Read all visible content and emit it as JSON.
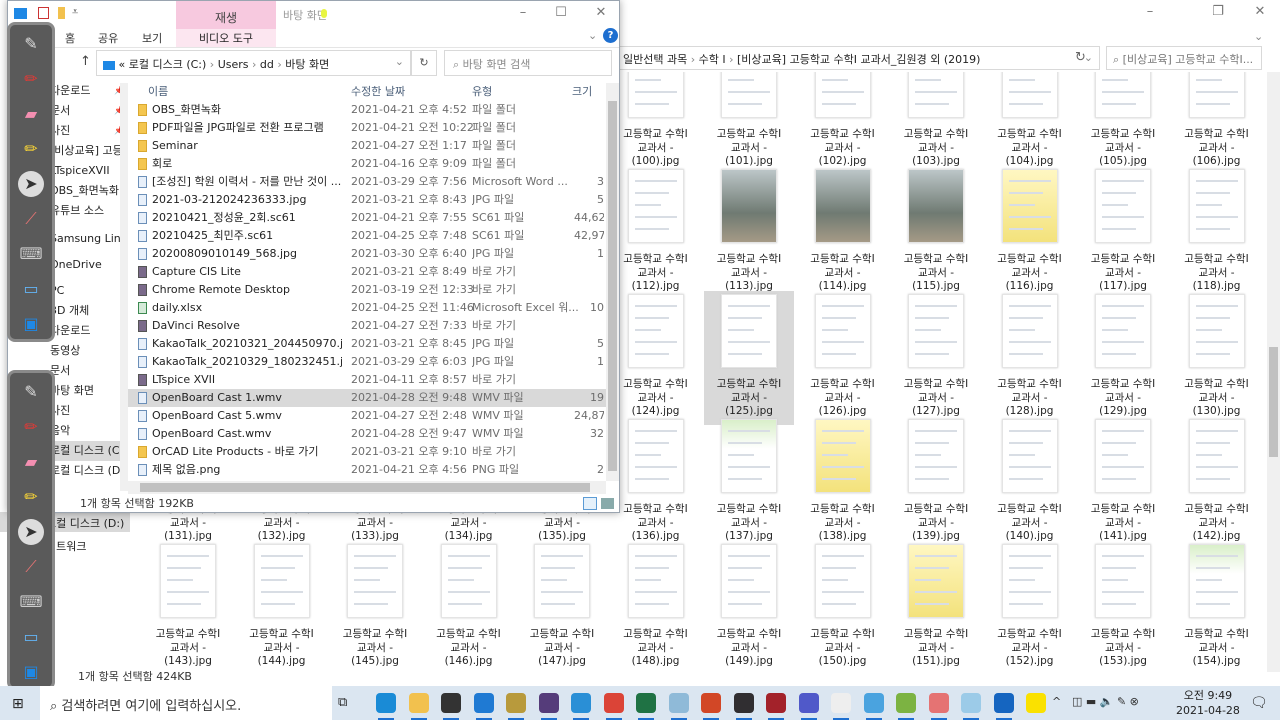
{
  "background_window": {
    "breadcrumb": [
      "일반선택 과목",
      "수학 I",
      "[비상교육] 고등학교 수학I 교과서_김원경 외 (2019)"
    ],
    "search_placeholder": "[비상교육] 고등학교 수학I...",
    "nav": [
      "로컬 디스크 (D:)",
      "네트워크"
    ],
    "status": "1개 항목 선택함 424KB",
    "label_line1": "고등학교 수학I",
    "label_line2": "교과서 -",
    "selected_file": "(125).jpg",
    "thumbnails": [
      {
        "file": "(100).jpg",
        "kind": "doc",
        "col": 5,
        "row": 0
      },
      {
        "file": "(101).jpg",
        "kind": "doc",
        "col": 6,
        "row": 0
      },
      {
        "file": "(102).jpg",
        "kind": "doc",
        "col": 7,
        "row": 0
      },
      {
        "file": "(103).jpg",
        "kind": "doc",
        "col": 8,
        "row": 0
      },
      {
        "file": "(104).jpg",
        "kind": "doc",
        "col": 9,
        "row": 0
      },
      {
        "file": "(105).jpg",
        "kind": "doc",
        "col": 10,
        "row": 0
      },
      {
        "file": "(106).jpg",
        "kind": "doc",
        "col": 11,
        "row": 0
      },
      {
        "file": "(112).jpg",
        "kind": "doc",
        "col": 5,
        "row": 1
      },
      {
        "file": "(113).jpg",
        "kind": "photo",
        "col": 6,
        "row": 1
      },
      {
        "file": "(114).jpg",
        "kind": "photo",
        "col": 7,
        "row": 1
      },
      {
        "file": "(115).jpg",
        "kind": "photo",
        "col": 8,
        "row": 1
      },
      {
        "file": "(116).jpg",
        "kind": "yellow",
        "col": 9,
        "row": 1
      },
      {
        "file": "(117).jpg",
        "kind": "doc",
        "col": 10,
        "row": 1
      },
      {
        "file": "(118).jpg",
        "kind": "doc",
        "col": 11,
        "row": 1
      },
      {
        "file": "(124).jpg",
        "kind": "doc",
        "col": 5,
        "row": 2
      },
      {
        "file": "(125).jpg",
        "kind": "doc",
        "col": 6,
        "row": 2
      },
      {
        "file": "(126).jpg",
        "kind": "doc",
        "col": 7,
        "row": 2
      },
      {
        "file": "(127).jpg",
        "kind": "doc",
        "col": 8,
        "row": 2
      },
      {
        "file": "(128).jpg",
        "kind": "doc",
        "col": 9,
        "row": 2
      },
      {
        "file": "(129).jpg",
        "kind": "doc",
        "col": 10,
        "row": 2
      },
      {
        "file": "(130).jpg",
        "kind": "doc",
        "col": 11,
        "row": 2
      },
      {
        "file": "(131).jpg",
        "kind": "doc",
        "col": 0,
        "row": 3
      },
      {
        "file": "(132).jpg",
        "kind": "doc",
        "col": 1,
        "row": 3
      },
      {
        "file": "(133).jpg",
        "kind": "doc",
        "col": 2,
        "row": 3
      },
      {
        "file": "(134).jpg",
        "kind": "doc",
        "col": 3,
        "row": 3
      },
      {
        "file": "(135).jpg",
        "kind": "doc",
        "col": 4,
        "row": 3
      },
      {
        "file": "(136).jpg",
        "kind": "doc",
        "col": 5,
        "row": 3
      },
      {
        "file": "(137).jpg",
        "kind": "green",
        "col": 6,
        "row": 3
      },
      {
        "file": "(138).jpg",
        "kind": "yellow",
        "col": 7,
        "row": 3
      },
      {
        "file": "(139).jpg",
        "kind": "doc",
        "col": 8,
        "row": 3
      },
      {
        "file": "(140).jpg",
        "kind": "doc",
        "col": 9,
        "row": 3
      },
      {
        "file": "(141).jpg",
        "kind": "doc",
        "col": 10,
        "row": 3
      },
      {
        "file": "(142).jpg",
        "kind": "doc",
        "col": 11,
        "row": 3
      },
      {
        "file": "(143).jpg",
        "kind": "doc",
        "col": 0,
        "row": 4
      },
      {
        "file": "(144).jpg",
        "kind": "doc",
        "col": 1,
        "row": 4
      },
      {
        "file": "(145).jpg",
        "kind": "doc",
        "col": 2,
        "row": 4
      },
      {
        "file": "(146).jpg",
        "kind": "doc",
        "col": 3,
        "row": 4
      },
      {
        "file": "(147).jpg",
        "kind": "doc",
        "col": 4,
        "row": 4
      },
      {
        "file": "(148).jpg",
        "kind": "doc",
        "col": 5,
        "row": 4
      },
      {
        "file": "(149).jpg",
        "kind": "doc",
        "col": 6,
        "row": 4
      },
      {
        "file": "(150).jpg",
        "kind": "doc",
        "col": 7,
        "row": 4
      },
      {
        "file": "(151).jpg",
        "kind": "yellow",
        "col": 8,
        "row": 4
      },
      {
        "file": "(152).jpg",
        "kind": "doc",
        "col": 9,
        "row": 4
      },
      {
        "file": "(153).jpg",
        "kind": "doc",
        "col": 10,
        "row": 4
      },
      {
        "file": "(154).jpg",
        "kind": "green",
        "col": 11,
        "row": 4
      }
    ]
  },
  "front_window": {
    "title": "바탕 화면",
    "context_tab": "재생",
    "ribbon_tabs": [
      "홈",
      "공유",
      "보기",
      "비디오 도구"
    ],
    "address": {
      "prefix": "«",
      "parts": [
        "로컬 디스크 (C:)",
        "Users",
        "dd",
        "바탕 화면"
      ]
    },
    "search_placeholder": "바탕 화면 검색",
    "nav": [
      {
        "label": "다운로드",
        "pinned": true
      },
      {
        "label": "문서",
        "pinned": true
      },
      {
        "label": "사진",
        "pinned": true
      },
      {
        "label": "[비상교육] 고등학"
      },
      {
        "label": "LTspiceXVII"
      },
      {
        "label": "OBS_화면녹화"
      },
      {
        "label": "유튜브 소스"
      },
      {
        "label": "Samsung Link"
      },
      {
        "label": "OneDrive"
      },
      {
        "label": "PC"
      },
      {
        "label": "3D 개체"
      },
      {
        "label": "다운로드"
      },
      {
        "label": "동영상"
      },
      {
        "label": "문서"
      },
      {
        "label": "바탕 화면"
      },
      {
        "label": "사진"
      },
      {
        "label": "음악"
      },
      {
        "label": "로컬 디스크 (C:)",
        "selected": true
      },
      {
        "label": "로컬 디스크 (D:)"
      }
    ],
    "columns": [
      "이름",
      "수정한 날짜",
      "유형",
      "크기"
    ],
    "files": [
      {
        "name": "OBS_화면녹화",
        "date": "2021-04-21 오후 4:52",
        "type": "파일 폴더",
        "size": "",
        "icon": "folder"
      },
      {
        "name": "PDF파일을 JPG파일로 전환 프로그램",
        "date": "2021-04-21 오전 10:22",
        "type": "파일 폴더",
        "size": "",
        "icon": "folder"
      },
      {
        "name": "Seminar",
        "date": "2021-04-27 오전 1:17",
        "type": "파일 폴더",
        "size": "",
        "icon": "folder"
      },
      {
        "name": "회로",
        "date": "2021-04-16 오후 9:09",
        "type": "파일 폴더",
        "size": "",
        "icon": "folder"
      },
      {
        "name": "[조성진] 학원 이력서 - 저를 만난 것이 ...",
        "date": "2021-03-29 오후 7:56",
        "type": "Microsoft Word ...",
        "size": "3",
        "icon": "file"
      },
      {
        "name": "2021-03-212024236333.jpg",
        "date": "2021-03-21 오후 8:43",
        "type": "JPG 파일",
        "size": "5",
        "icon": "file"
      },
      {
        "name": "20210421_정성윤_2회.sc61",
        "date": "2021-04-21 오후 7:55",
        "type": "SC61 파일",
        "size": "44,62",
        "icon": "file"
      },
      {
        "name": "20210425_최민주.sc61",
        "date": "2021-04-25 오후 7:48",
        "type": "SC61 파일",
        "size": "42,97",
        "icon": "file"
      },
      {
        "name": "20200809010149_568.jpg",
        "date": "2021-03-30 오후 6:40",
        "type": "JPG 파일",
        "size": "1",
        "icon": "file"
      },
      {
        "name": "Capture CIS Lite",
        "date": "2021-03-21 오후 8:49",
        "type": "바로 가기",
        "size": "",
        "icon": "short"
      },
      {
        "name": "Chrome Remote Desktop",
        "date": "2021-03-19 오전 12:33",
        "type": "바로 가기",
        "size": "",
        "icon": "short"
      },
      {
        "name": "daily.xlsx",
        "date": "2021-04-25 오전 11:46",
        "type": "Microsoft Excel 워...",
        "size": "10",
        "icon": "xls"
      },
      {
        "name": "DaVinci Resolve",
        "date": "2021-04-27 오전 7:33",
        "type": "바로 가기",
        "size": "",
        "icon": "short"
      },
      {
        "name": "KakaoTalk_20210321_204450970.jpg",
        "date": "2021-03-21 오후 8:45",
        "type": "JPG 파일",
        "size": "5",
        "icon": "file"
      },
      {
        "name": "KakaoTalk_20210329_180232451.jpg",
        "date": "2021-03-29 오후 6:03",
        "type": "JPG 파일",
        "size": "1",
        "icon": "file"
      },
      {
        "name": "LTspice XVII",
        "date": "2021-04-11 오후 8:57",
        "type": "바로 가기",
        "size": "",
        "icon": "short"
      },
      {
        "name": "OpenBoard Cast 1.wmv",
        "date": "2021-04-28 오전 9:48",
        "type": "WMV 파일",
        "size": "19",
        "icon": "file",
        "selected": true
      },
      {
        "name": "OpenBoard Cast 5.wmv",
        "date": "2021-04-27 오전 2:48",
        "type": "WMV 파일",
        "size": "24,87",
        "icon": "file"
      },
      {
        "name": "OpenBoard Cast.wmv",
        "date": "2021-04-28 오전 9:47",
        "type": "WMV 파일",
        "size": "32",
        "icon": "file"
      },
      {
        "name": "OrCAD Lite Products - 바로 가기",
        "date": "2021-03-21 오후 9:10",
        "type": "바로 가기",
        "size": "",
        "icon": "folder"
      },
      {
        "name": "제목 없음.png",
        "date": "2021-04-21 오후 4:56",
        "type": "PNG 파일",
        "size": "2",
        "icon": "file"
      }
    ],
    "status": "1개 항목 선택함 192KB"
  },
  "openboard_tools": [
    "pen-tool-icon",
    "red-pen-icon",
    "eraser-icon",
    "marker-icon",
    "pointer-icon",
    "laser-pointer-icon",
    "keyboard-icon",
    "capture-icon",
    "display-icon"
  ],
  "taskbar": {
    "search_placeholder": "검색하려면 여기에 입력하십시오.",
    "apps": [
      {
        "name": "edge",
        "color": "#1a8bd6"
      },
      {
        "name": "file-explorer",
        "color": "#f2c14e"
      },
      {
        "name": "store",
        "color": "#333333"
      },
      {
        "name": "mail",
        "color": "#1f7ad3"
      },
      {
        "name": "app",
        "color": "#b89a3c"
      },
      {
        "name": "app2",
        "color": "#553c7a"
      },
      {
        "name": "internet-explorer",
        "color": "#2a8fd6"
      },
      {
        "name": "chrome",
        "color": "#db4437"
      },
      {
        "name": "excel",
        "color": "#1f7244"
      },
      {
        "name": "notes",
        "color": "#8fbad8"
      },
      {
        "name": "powerpoint",
        "color": "#d24726"
      },
      {
        "name": "obs",
        "color": "#302e31"
      },
      {
        "name": "ltspice",
        "color": "#a3222a"
      },
      {
        "name": "teams",
        "color": "#5059c9"
      },
      {
        "name": "whiteboard",
        "color": "#eeeeee"
      },
      {
        "name": "remote",
        "color": "#4aa3df"
      },
      {
        "name": "bluestacks",
        "color": "#7cb342"
      },
      {
        "name": "snipping",
        "color": "#e57373"
      },
      {
        "name": "paint",
        "color": "#9ccbe8"
      },
      {
        "name": "photos",
        "color": "#1565c0"
      },
      {
        "name": "kakaotalk",
        "color": "#fae100"
      }
    ],
    "time": "오전 9:49",
    "date": "2021-04-28"
  }
}
